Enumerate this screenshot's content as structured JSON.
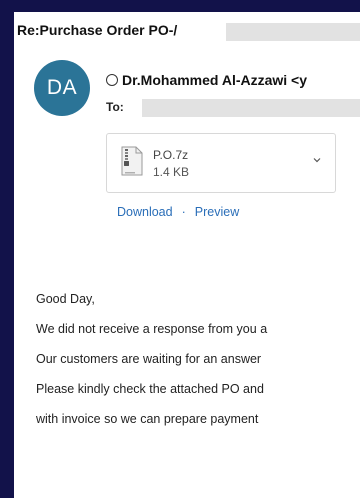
{
  "email": {
    "subject": "Re:Purchase Order PO-/",
    "sender": "Dr.Mohammed Al-Azzawi <y",
    "avatar_initials": "DA",
    "to_label": "To:",
    "attachment": {
      "name": "P.O.7z",
      "size": "1.4 KB",
      "icon": "archive-file-icon"
    },
    "actions": {
      "download": "Download",
      "separator": "·",
      "preview": "Preview"
    },
    "body_lines": [
      "Good Day,",
      "We did not receive a response from you a",
      "Our customers are waiting for an answer",
      "Please kindly check the attached PO and",
      "with invoice so we can prepare payment"
    ]
  },
  "colors": {
    "background": "#12124a",
    "avatar": "#2b7497",
    "link": "#2a6eb8"
  }
}
